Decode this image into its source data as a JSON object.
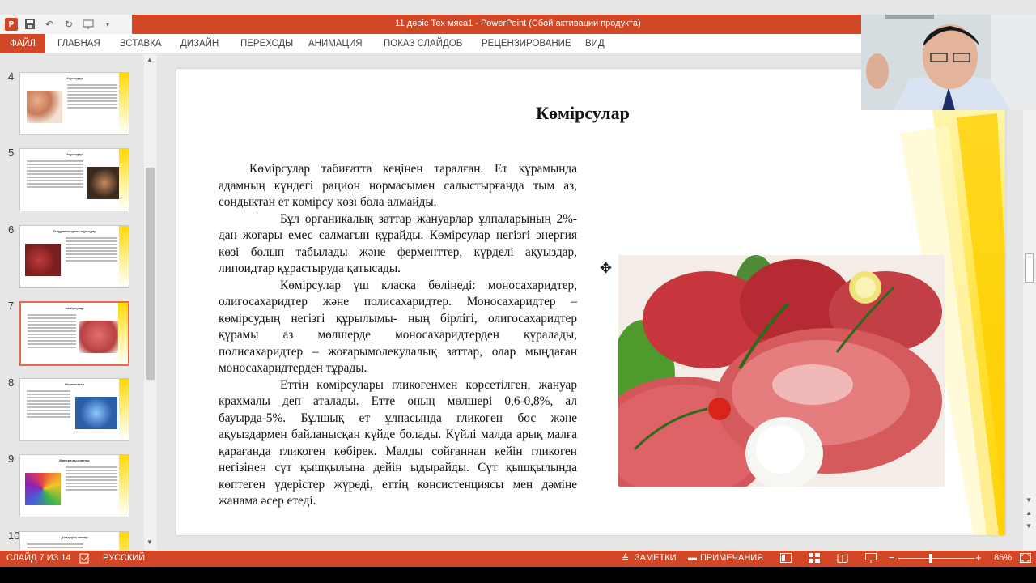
{
  "window": {
    "title": "11 дәріс Тех мяса1 - PowerPoint (Сбой активации продукта)"
  },
  "ribbon": {
    "tabs": [
      "ФАЙЛ",
      "ГЛАВНАЯ",
      "ВСТАВКА",
      "ДИЗАЙН",
      "ПЕРЕХОДЫ",
      "АНИМАЦИЯ",
      "ПОКАЗ СЛАЙДОВ",
      "РЕЦЕНЗИРОВАНИЕ",
      "ВИД"
    ]
  },
  "thumbnails": [
    {
      "num": "4",
      "title": "Ақуыздар"
    },
    {
      "num": "5",
      "title": "Ақуыздар"
    },
    {
      "num": "6",
      "title": "Ет құрамындағы ақуыздар"
    },
    {
      "num": "7",
      "title": "Көмірсулар"
    },
    {
      "num": "8",
      "title": "Ферменттер"
    },
    {
      "num": "9",
      "title": "Минералды заттар"
    },
    {
      "num": "10",
      "title": "Дәмдеуіш заттар"
    }
  ],
  "slide": {
    "title": "Көмірсулар",
    "paragraphs": [
      "Көмірсулар табиғатта кеңінен таралған. Ет құрамында адамның күндегі рацион нормасымен салыстырғанда тым аз, сондықтан ет көмірсу көзі бола алмайды.",
      "Бұл органикалық заттар жануарлар ұлпаларының 2%-дан жоғары емес салмағын құрайды. Көмірсулар негізгі энергия көзі болып табылады және ферменттер, күрделі ақуыздар, липоидтар құрастыруда қатысады.",
      "Көмірсулар үш класқа бөлінеді: моносахаридтер, олигосахаридтер және полисахаридтер. Моносахаридтер – көмірсудың негізгі құрылымы- ның бірлігі, олигосахаридтер құрамы аз мөлшерде моносахаридтерден құралады, полисахаридтер – жоғарымолекулалық заттар, олар мыңдаған моносахаридтерден тұрады.",
      "Еттің көмірсулары гликогенмен көрсетілген, жануар крахмалы деп аталады. Етте оның мөлшері 0,6-0,8%, ал бауырда-5%. Бұлшық ет ұлпасында гликоген бос және ақуыздармен байланысқан күйде болады. Күйлі малда арық малға қарағанда гликоген көбірек. Малды сойғаннан кейін гликоген негізінен сүт қышқылына дейін ыдырайды. Сүт қышқылында көптеген үдерістер жүреді, еттің консистенциясы мен дәміне жанама әсер етеді."
    ]
  },
  "status": {
    "slide_counter": "СЛАЙД 7 ИЗ 14",
    "language": "РУССКИЙ",
    "notes": "ЗАМЕТКИ",
    "comments": "ПРИМЕЧАНИЯ",
    "zoom": "86%"
  },
  "colors": {
    "accent": "#d24726",
    "slide_stripe": "#ffd800"
  }
}
